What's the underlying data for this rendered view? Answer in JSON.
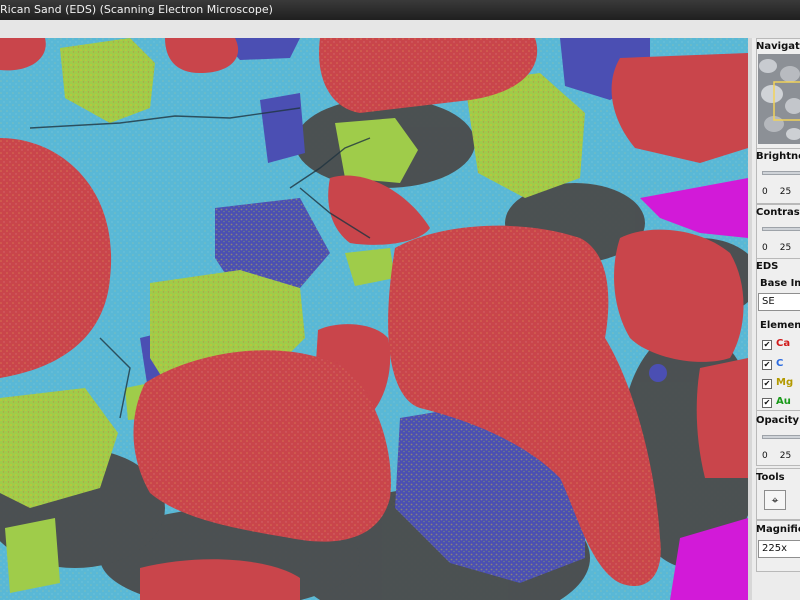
{
  "window": {
    "title": "Rican Sand (EDS) (Scanning Electron Microscope)"
  },
  "sidebar": {
    "navigator": {
      "title": "Navigator"
    },
    "brightness": {
      "title": "Brightness",
      "ticks": [
        "0",
        "25"
      ]
    },
    "contrast": {
      "title": "Contrast",
      "ticks": [
        "0",
        "25"
      ]
    },
    "eds": {
      "title": "EDS",
      "base_image_label": "Base Image",
      "base_image_value": "SE",
      "elements_title": "Elements",
      "elements": [
        {
          "label": "Ca",
          "checked": true,
          "color": "#d11a1a"
        },
        {
          "label": "C",
          "checked": true,
          "color": "#2a6be0"
        },
        {
          "label": "Mg",
          "checked": true,
          "color": "#b39a00"
        },
        {
          "label": "Au",
          "checked": true,
          "color": "#1a9a1a"
        }
      ],
      "check_mark": "✔"
    },
    "opacity": {
      "title": "Opacity",
      "ticks": [
        "0",
        "25"
      ]
    },
    "tools": {
      "title": "Tools",
      "crosshair_glyph": "⌖"
    },
    "magnification": {
      "title": "Magnification",
      "value": "225x"
    }
  },
  "colors": {
    "background_blue": "#59b8d6",
    "calcium_red": "#c9454b",
    "magnesium_green": "#9fcc4a",
    "carbon_blue": "#4b4fb3",
    "gold_magenta": "#d21ad8",
    "shadow_gray": "#4b4b4b"
  }
}
